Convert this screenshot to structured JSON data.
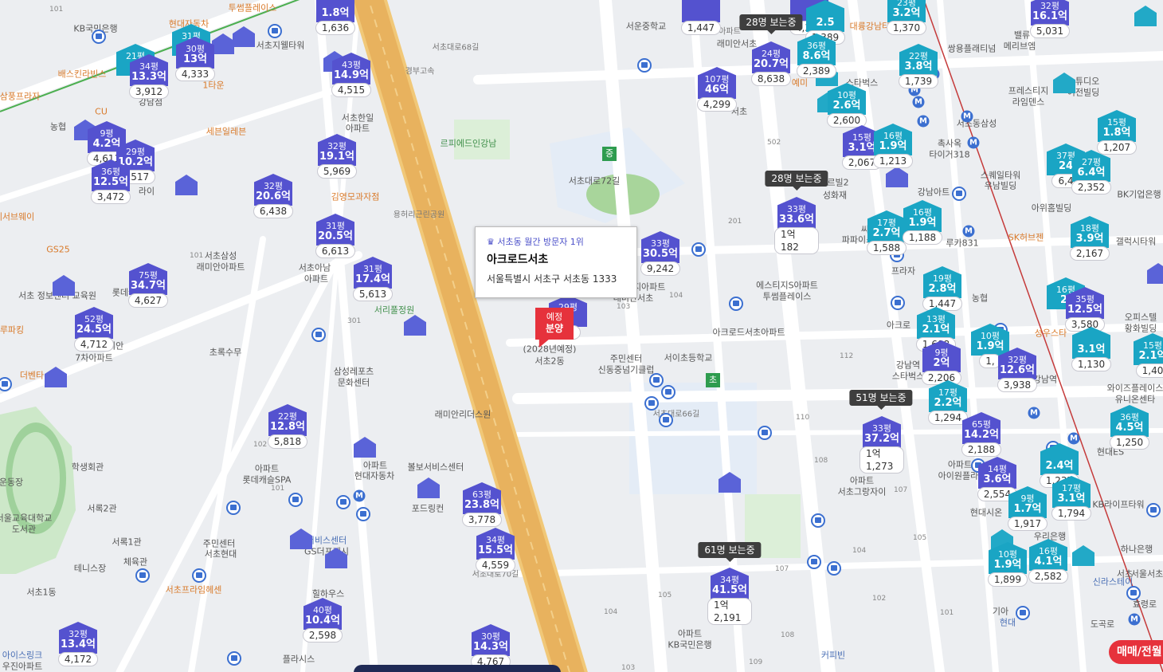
{
  "map": {
    "popup": {
      "rank": "서초동 월간 방문자 1위",
      "name": "아크로드서초",
      "address": "서울특별시 서초구 서초동 1333"
    },
    "presale": {
      "line1": "예정",
      "line2": "분양"
    },
    "trade_button": "매매/전월",
    "colors": {
      "marker_purple": "#5452cf",
      "marker_teal": "#1aa5c4",
      "presale_red": "#e6323c",
      "expressway": "#e8b25e"
    },
    "markers": [
      {
        "size": "",
        "price": "1.8억",
        "count": "1,636",
        "color": "purple"
      },
      {
        "size": "",
        "price": "",
        "count": "1,447",
        "color": "purple"
      },
      {
        "size": "",
        "price": "",
        "count": "4,355",
        "color": "purple"
      },
      {
        "size": "",
        "price": "2.5",
        "count": "1,389",
        "color": "teal"
      },
      {
        "size": "23평",
        "price": "3.2억",
        "count": "1,370",
        "color": "teal"
      },
      {
        "size": "32평",
        "price": "16.1억",
        "count": "5,031",
        "color": "purple"
      },
      {
        "size": "31평",
        "price": "",
        "count": "",
        "color": "teal"
      },
      {
        "size": "21평",
        "price": "3",
        "count": "",
        "color": "teal"
      },
      {
        "size": "34평",
        "price": "13.3억",
        "count": "3,912",
        "color": "purple"
      },
      {
        "size": "30평",
        "price": "13억",
        "count": "4,333",
        "color": "purple"
      },
      {
        "size": "43평",
        "price": "14.9억",
        "count": "4,515",
        "color": "purple"
      },
      {
        "size": "24평",
        "price": "20.7억",
        "count": "8,638",
        "color": "purple"
      },
      {
        "size": "36평",
        "price": "8.6억",
        "count": "2,389",
        "color": "teal"
      },
      {
        "size": "22평",
        "price": "3.8억",
        "count": "1,739",
        "color": "teal"
      },
      {
        "size": "107평",
        "price": "46억",
        "count": "4,299",
        "color": "purple"
      },
      {
        "size": "10평",
        "price": "2.6억",
        "count": "2,600",
        "color": "teal"
      },
      {
        "size": "15평",
        "price": "1.8억",
        "count": "1,207",
        "color": "teal"
      },
      {
        "size": "9평",
        "price": "4.2억",
        "count": "4,611",
        "color": "purple"
      },
      {
        "size": "29평",
        "price": "10.2억",
        "count": "3,517",
        "color": "purple"
      },
      {
        "size": "36평",
        "price": "12.5억",
        "count": "3,472",
        "color": "purple"
      },
      {
        "size": "32평",
        "price": "19.1억",
        "count": "5,969",
        "color": "purple"
      },
      {
        "size": "15평",
        "price": "3.1억",
        "count": "2,067",
        "color": "purple"
      },
      {
        "size": "16평",
        "price": "1.9억",
        "count": "1,213",
        "color": "teal"
      },
      {
        "size": "37평",
        "price": "24",
        "count": "6,4",
        "color": "teal"
      },
      {
        "size": "27평",
        "price": "6.4억",
        "count": "2,352",
        "color": "teal"
      },
      {
        "size": "32평",
        "price": "20.6억",
        "count": "6,438",
        "color": "purple"
      },
      {
        "size": "33평",
        "price": "33.6억",
        "count": "1억182",
        "color": "purple"
      },
      {
        "size": "17평",
        "price": "2.7억",
        "count": "1,588",
        "color": "teal"
      },
      {
        "size": "16평",
        "price": "1.9억",
        "count": "1,188",
        "color": "teal"
      },
      {
        "size": "18평",
        "price": "3.9억",
        "count": "2,167",
        "color": "teal"
      },
      {
        "size": "31평",
        "price": "20.5억",
        "count": "6,613",
        "color": "purple"
      },
      {
        "size": "33평",
        "price": "30.5억",
        "count": "9,242",
        "color": "purple"
      },
      {
        "size": "31평",
        "price": "17.4억",
        "count": "5,613",
        "color": "purple"
      },
      {
        "size": "75평",
        "price": "34.7억",
        "count": "4,627",
        "color": "purple"
      },
      {
        "size": "29평",
        "price": "",
        "count": "48",
        "color": "purple"
      },
      {
        "size": "19평",
        "price": "2.8억",
        "count": "1,447",
        "color": "teal"
      },
      {
        "size": "16평",
        "price": "2.",
        "count": "",
        "color": "teal"
      },
      {
        "size": "35평",
        "price": "12.5억",
        "count": "3,580",
        "color": "purple"
      },
      {
        "size": "52평",
        "price": "24.5억",
        "count": "4,712",
        "color": "purple"
      },
      {
        "size": "13평",
        "price": "2.1억",
        "count": "1,608",
        "color": "teal"
      },
      {
        "size": "10평",
        "price": "1.9억",
        "count": "1,",
        "color": "teal"
      },
      {
        "size": "",
        "price": "3.1억",
        "count": "1,130",
        "color": "teal"
      },
      {
        "size": "15평",
        "price": "2.1억",
        "count": "1,40",
        "color": "teal"
      },
      {
        "size": "9평",
        "price": "2억",
        "count": "2,206",
        "color": "purple"
      },
      {
        "size": "32평",
        "price": "12.6억",
        "count": "3,938",
        "color": "purple"
      },
      {
        "size": "17평",
        "price": "2.2억",
        "count": "1,294",
        "color": "teal"
      },
      {
        "size": "36평",
        "price": "4.5억",
        "count": "1,250",
        "color": "teal"
      },
      {
        "size": "22평",
        "price": "12.8억",
        "count": "5,818",
        "color": "purple"
      },
      {
        "size": "33평",
        "price": "37.2억",
        "count": "1억1,273",
        "color": "purple"
      },
      {
        "size": "65평",
        "price": "14.2억",
        "count": "2,188",
        "color": "purple"
      },
      {
        "size": "",
        "price": "2.4억",
        "count": "1,237",
        "color": "teal"
      },
      {
        "size": "14평",
        "price": "3.6억",
        "count": "2,554",
        "color": "purple"
      },
      {
        "size": "9평",
        "price": "1.7억",
        "count": "1,917",
        "color": "teal"
      },
      {
        "size": "17평",
        "price": "3.1억",
        "count": "1,794",
        "color": "teal"
      },
      {
        "size": "63평",
        "price": "23.8억",
        "count": "3,778",
        "color": "purple"
      },
      {
        "size": "34평",
        "price": "15.5억",
        "count": "4,559",
        "color": "purple"
      },
      {
        "size": "34평",
        "price": "41.5억",
        "count": "1억2,191",
        "color": "purple"
      },
      {
        "size": "10평",
        "price": "1.9억",
        "count": "1,899",
        "color": "teal"
      },
      {
        "size": "16평",
        "price": "4.1억",
        "count": "2,582",
        "color": "teal"
      },
      {
        "size": "40평",
        "price": "10.4억",
        "count": "2,598",
        "color": "purple"
      },
      {
        "size": "32평",
        "price": "13.4억",
        "count": "4,172",
        "color": "purple"
      },
      {
        "size": "30평",
        "price": "14.3억",
        "count": "4,767",
        "color": "purple"
      }
    ],
    "viewer_badges": [
      "28명 보는중",
      "28명 보는중",
      "51명 보는중",
      "61명 보는중"
    ],
    "labels": [
      "KB국민은행",
      "현대자동차",
      "투썸플레이스",
      "서초지웰타워",
      "배스킨라빈스",
      "강남점",
      "삼풍프라자",
      "CU",
      "농협",
      "1타운",
      "세븐일레븐",
      "서초동",
      "라이",
      "메서브웨이",
      "GS25",
      "서초한일",
      "아파트",
      "서초삼성",
      "래미안아파트",
      "서초아남",
      "아파트",
      "김영모과자점",
      "서리풀정원",
      "서초 정보센터 교육원",
      "롯데캐슬",
      "루파킹",
      "초록수무",
      "서초래미안",
      "7차아파트",
      "더벤타",
      "삼성레포츠",
      "문화센터",
      "학생회관",
      "운동장",
      "서울교육대학교",
      "도서관",
      "서록2관",
      "서록1관",
      "테니스장",
      "체육관",
      "서초1동",
      "주민센터",
      "서초현대",
      "아파트",
      "롯데캐슬SPA",
      "아파트",
      "현대자동차",
      "볼보서비스센터",
      "포드링컨",
      "서비스센터",
      "GS더프레시",
      "서초프라임헤센",
      "힐하우스",
      "플라시스",
      "아이스링크",
      "우진아파트",
      "서초대로70길",
      "서초대로68길",
      "경부고속",
      "용허리근린공원",
      "르피에드인강남",
      "서운중학교",
      "서초대로72길",
      "서초",
      "아파트",
      "래미안서초",
      "에스티지아파트",
      "래미안서초",
      "에스티지S아파트",
      "투썸플레이스",
      "아크로드서초아파트",
      "(2028년예정)",
      "서초2동",
      "주민센터",
      "신동중넘기클럽",
      "서이초등학교",
      "서초대로66길",
      "래미안리더스원",
      "아파트",
      "서초그랑자이",
      "아파트",
      "KB국민은행",
      "커피빈",
      "대륭강남타워",
      "쌍용플래티넘",
      "밸류",
      "메리브엠",
      "스타벅스",
      "예미",
      "프레스티지",
      "라임덴스",
      "스튜디오",
      "여전빌딩",
      "서초동삼성",
      "쉐르빌2",
      "성화재",
      "촉사옥",
      "타이거318",
      "스퀘일타워",
      "우남빌딩",
      "강남아트",
      "씨티",
      "파파이스",
      "루카831",
      "SK허브젠",
      "아위홈빌딩",
      "BK기업은행",
      "갤럭시타워",
      "프라자",
      "농협",
      "아크로",
      "강남역",
      "스타벅스",
      "성우스타",
      "오피스텔",
      "황화빌딩",
      "강남역",
      "와이즈플레이스",
      "유니온센타",
      "현대ES",
      "아파트",
      "아이원플라자",
      "현대시온",
      "우리은행",
      "KB라이프타워",
      "하나은행",
      "신라스테이",
      "서초",
      "기아",
      "현대",
      "도곡로",
      "효령로",
      "서울서초"
    ]
  }
}
